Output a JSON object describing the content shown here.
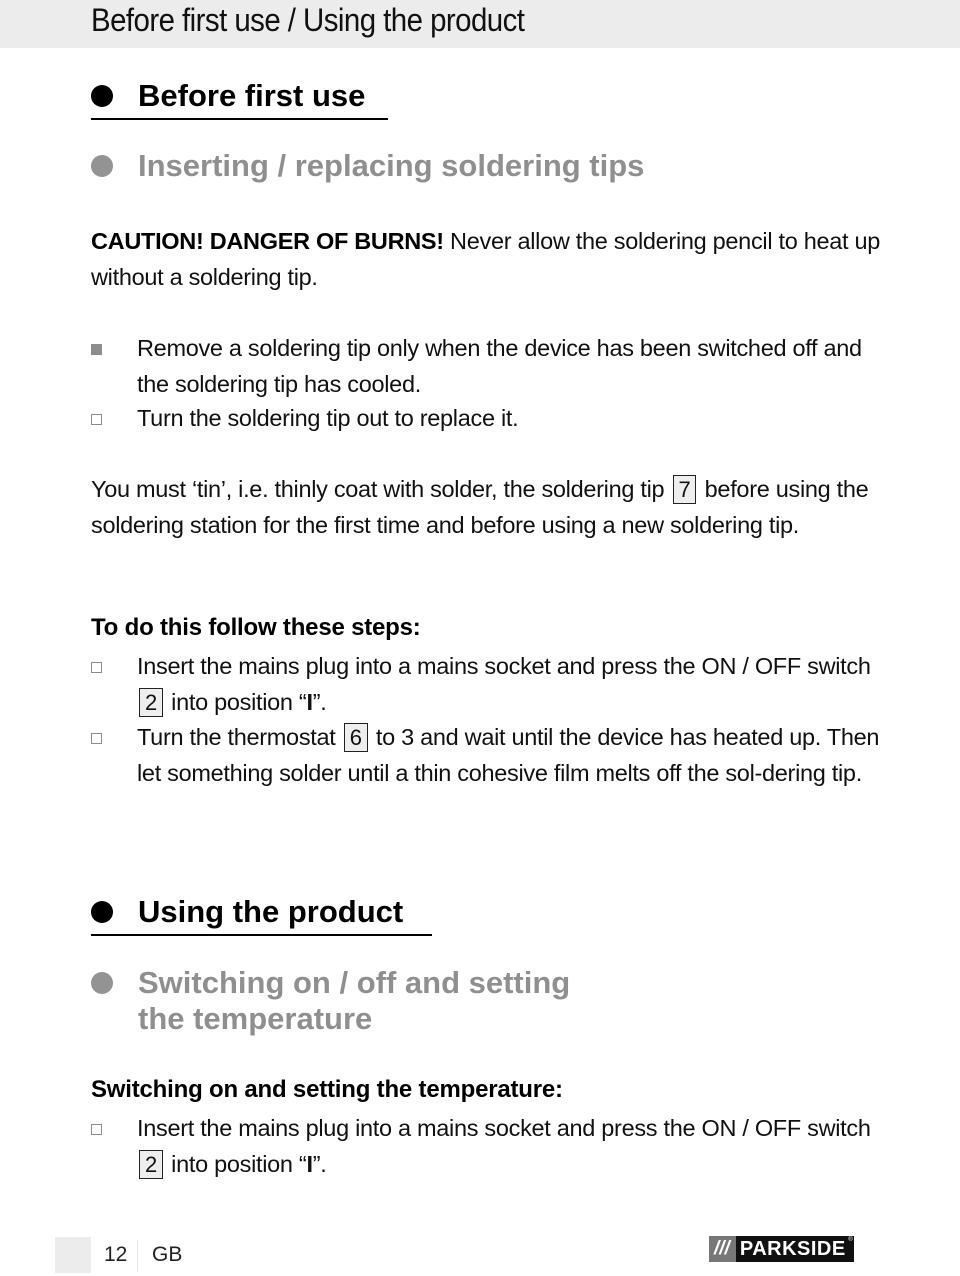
{
  "header": {
    "title": "Before first use / Using the product"
  },
  "sections": {
    "before_first_use": {
      "heading": "Before first use"
    },
    "inserting_tips": {
      "heading": "Inserting / replacing soldering tips"
    },
    "caution": {
      "bold": "CAUTION! DANGER OF BURNS!",
      "text": " Never allow the soldering pencil to heat up without a soldering tip."
    },
    "remove_bullets": [
      {
        "marker": "filled-square",
        "text": "Remove a soldering tip only when the device has been switched off and the soldering tip has cooled."
      },
      {
        "marker": "hollow-square",
        "text": "Turn the soldering tip out to replace it."
      }
    ],
    "tinning": {
      "before_ref": "You must ‘tin’, i.e. thinly coat with solder, the soldering tip ",
      "ref": "7",
      "after_ref": " before using the soldering station for the first time and before using a new soldering tip."
    },
    "steps": {
      "heading": "To do this follow these steps:",
      "items": [
        {
          "marker": "hollow-square",
          "before_ref": "Insert the mains plug into a mains socket and press the ON / OFF switch ",
          "ref": "2",
          "after_ref": " into position “",
          "bold": "I",
          "end": "”."
        },
        {
          "marker": "hollow-square",
          "before_ref": "Turn the thermostat ",
          "ref": "6",
          "after_ref": " to 3 and wait until the device has heated up. Then let something solder until a thin cohesive film melts off the sol-dering tip."
        }
      ]
    },
    "using_product": {
      "heading": "Using the product"
    },
    "switching": {
      "heading_line1": "Switching on / off and setting",
      "heading_line2": "the temperature"
    },
    "switching_on": {
      "heading": "Switching on and setting the temperature:",
      "items": [
        {
          "marker": "hollow-square",
          "before_ref": "Insert the mains plug into a mains socket and press the ON / OFF switch ",
          "ref": "2",
          "after_ref": " into position “",
          "bold": "I",
          "end": "”."
        }
      ]
    }
  },
  "footer": {
    "page_number": "12",
    "language": "GB",
    "logo_slashes": "///",
    "logo_brand": "PARKSIDE",
    "logo_mark": "®"
  }
}
